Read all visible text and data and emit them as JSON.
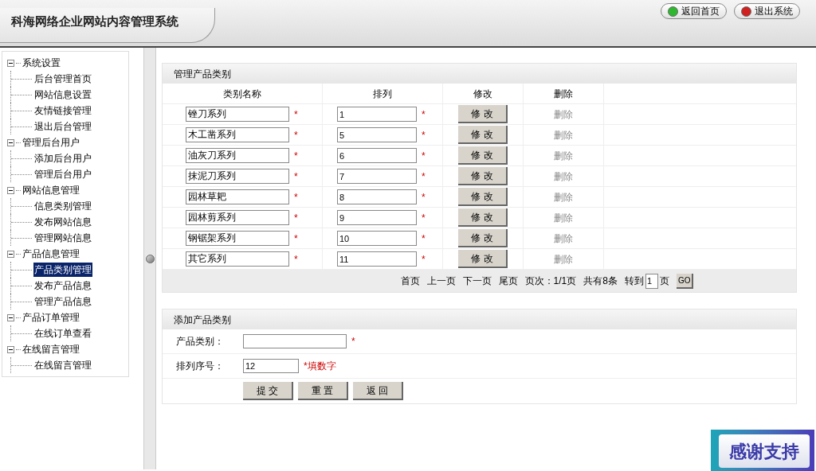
{
  "header": {
    "title": "科海网络企业网站内容管理系统",
    "buttons": [
      {
        "label": "返回首页",
        "color": "#2fb82f"
      },
      {
        "label": "退出系统",
        "color": "#d02020"
      }
    ]
  },
  "sidebar": {
    "items": [
      {
        "label": "系统设置",
        "expanded": true,
        "children": [
          {
            "label": "后台管理首页",
            "selected": false
          },
          {
            "label": "网站信息设置",
            "selected": false
          },
          {
            "label": "友情链接管理",
            "selected": false
          },
          {
            "label": "退出后台管理",
            "selected": false
          }
        ]
      },
      {
        "label": "管理后台用户",
        "expanded": true,
        "children": [
          {
            "label": "添加后台用户",
            "selected": false
          },
          {
            "label": "管理后台用户",
            "selected": false
          }
        ]
      },
      {
        "label": "网站信息管理",
        "expanded": true,
        "children": [
          {
            "label": "信息类别管理",
            "selected": false
          },
          {
            "label": "发布网站信息",
            "selected": false
          },
          {
            "label": "管理网站信息",
            "selected": false
          }
        ]
      },
      {
        "label": "产品信息管理",
        "expanded": true,
        "children": [
          {
            "label": "产品类别管理",
            "selected": true
          },
          {
            "label": "发布产品信息",
            "selected": false
          },
          {
            "label": "管理产品信息",
            "selected": false
          }
        ]
      },
      {
        "label": "产品订单管理",
        "expanded": true,
        "children": [
          {
            "label": "在线订单查看",
            "selected": false
          }
        ]
      },
      {
        "label": "在线留言管理",
        "expanded": true,
        "children": [
          {
            "label": "在线留言管理",
            "selected": false
          }
        ]
      }
    ]
  },
  "manage": {
    "title": "管理产品类别",
    "columns": [
      "类别名称",
      "排列",
      "修改",
      "删除"
    ],
    "rows": [
      {
        "name": "锉刀系列",
        "order": "1",
        "required": "*",
        "edit": "修 改",
        "delete": "删除"
      },
      {
        "name": "木工凿系列",
        "order": "5",
        "required": "*",
        "edit": "修 改",
        "delete": "删除"
      },
      {
        "name": "油灰刀系列",
        "order": "6",
        "required": "*",
        "edit": "修 改",
        "delete": "删除"
      },
      {
        "name": "抹泥刀系列",
        "order": "7",
        "required": "*",
        "edit": "修 改",
        "delete": "删除"
      },
      {
        "name": "园林草耙",
        "order": "8",
        "required": "*",
        "edit": "修 改",
        "delete": "删除"
      },
      {
        "name": "园林剪系列",
        "order": "9",
        "required": "*",
        "edit": "修 改",
        "delete": "删除"
      },
      {
        "name": "钢锯架系列",
        "order": "10",
        "required": "*",
        "edit": "修 改",
        "delete": "删除"
      },
      {
        "name": "其它系列",
        "order": "11",
        "required": "*",
        "edit": "修 改",
        "delete": "删除"
      }
    ],
    "pagination": {
      "links": [
        "首页",
        "上一页",
        "下一页",
        "尾页"
      ],
      "page_info": "页次：1/1页",
      "total": "共有8条",
      "goto_label": "转到",
      "goto_value": "1",
      "page_unit": "页",
      "go": "GO"
    }
  },
  "add": {
    "title": "添加产品类别",
    "fields": [
      {
        "label": "产品类别：",
        "hint": "*"
      },
      {
        "label": "排列序号：",
        "value": "12",
        "hint": "*填数字"
      }
    ],
    "buttons": [
      "提 交",
      "重 置",
      "返 回"
    ]
  },
  "badge": {
    "text": "感谢支持"
  }
}
